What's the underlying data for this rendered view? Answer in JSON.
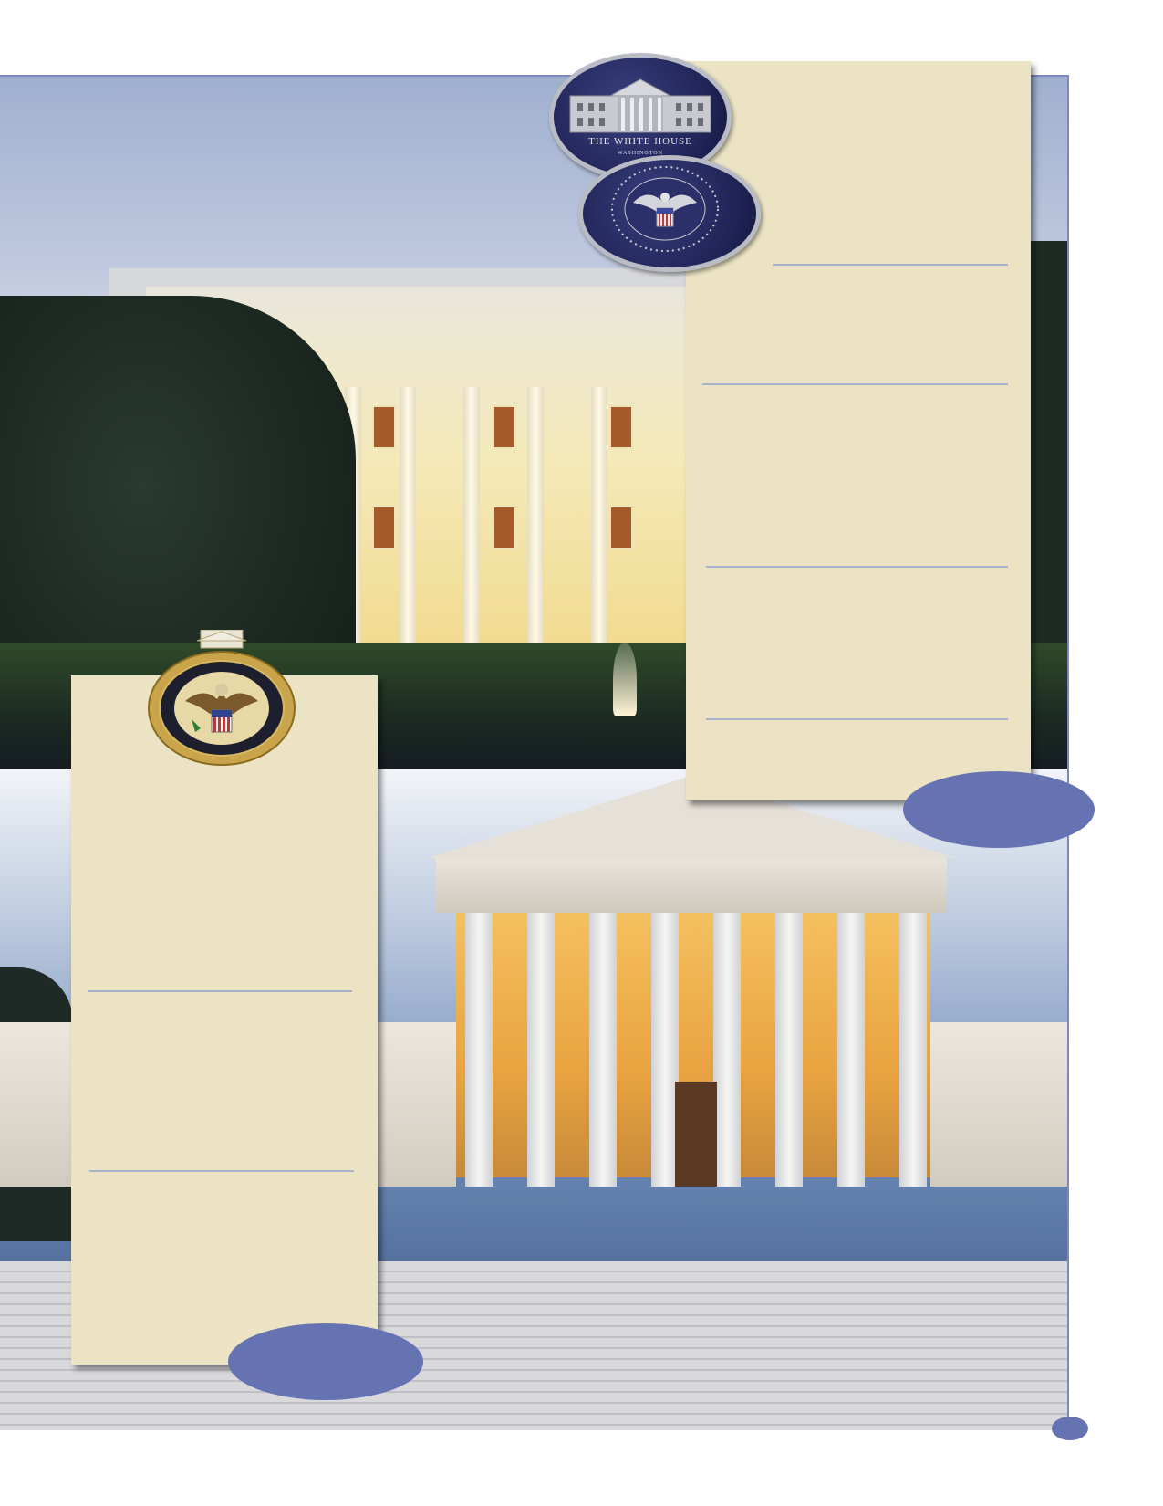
{
  "coin_white_house": {
    "title": "THE WHITE HOUSE",
    "subtitle": "WASHINGTON"
  },
  "colors": {
    "panel": "#ebe3c4",
    "accent_oval": "#6673b3",
    "frame": "#7f86c0",
    "rule": "#a8b2cc"
  },
  "icons": {
    "white_house_coin": "white-house-coin-icon",
    "presidential_seal_coin": "presidential-seal-coin-icon",
    "secret_service_badge": "secret-service-badge-icon"
  }
}
